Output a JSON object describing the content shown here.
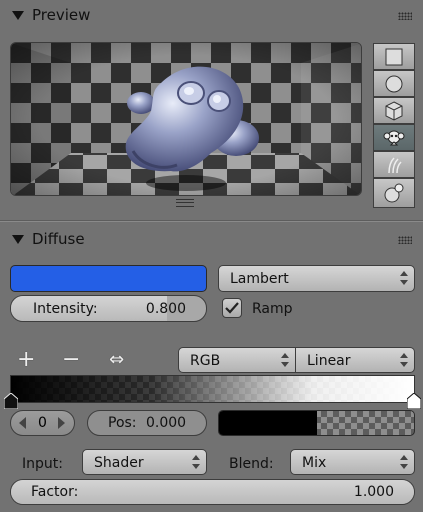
{
  "preview": {
    "title": "Preview",
    "side_buttons": [
      {
        "icon": "plane-icon",
        "active": false
      },
      {
        "icon": "sphere-icon",
        "active": false
      },
      {
        "icon": "cube-icon",
        "active": false
      },
      {
        "icon": "monkey-icon",
        "active": true
      },
      {
        "icon": "hair-icon",
        "active": false
      },
      {
        "icon": "sphere-sky-icon",
        "active": false
      }
    ]
  },
  "diffuse": {
    "title": "Diffuse",
    "color": "#245fe6",
    "shader": "Lambert",
    "intensity_label": "Intensity:",
    "intensity_value": "0.800",
    "intensity_fraction": 0.8,
    "ramp_label": "Ramp",
    "ramp_checked": true
  },
  "ramp": {
    "color_mode": "RGB",
    "interpolation": "Linear",
    "index": "0",
    "pos_label": "Pos:",
    "pos_value": "0.000",
    "stop_color": "#000000",
    "stop_alpha_fraction": 0.5
  },
  "input": {
    "input_label": "Input:",
    "input_value": "Shader",
    "blend_label": "Blend:",
    "blend_value": "Mix",
    "factor_label": "Factor:",
    "factor_value": "1.000"
  }
}
